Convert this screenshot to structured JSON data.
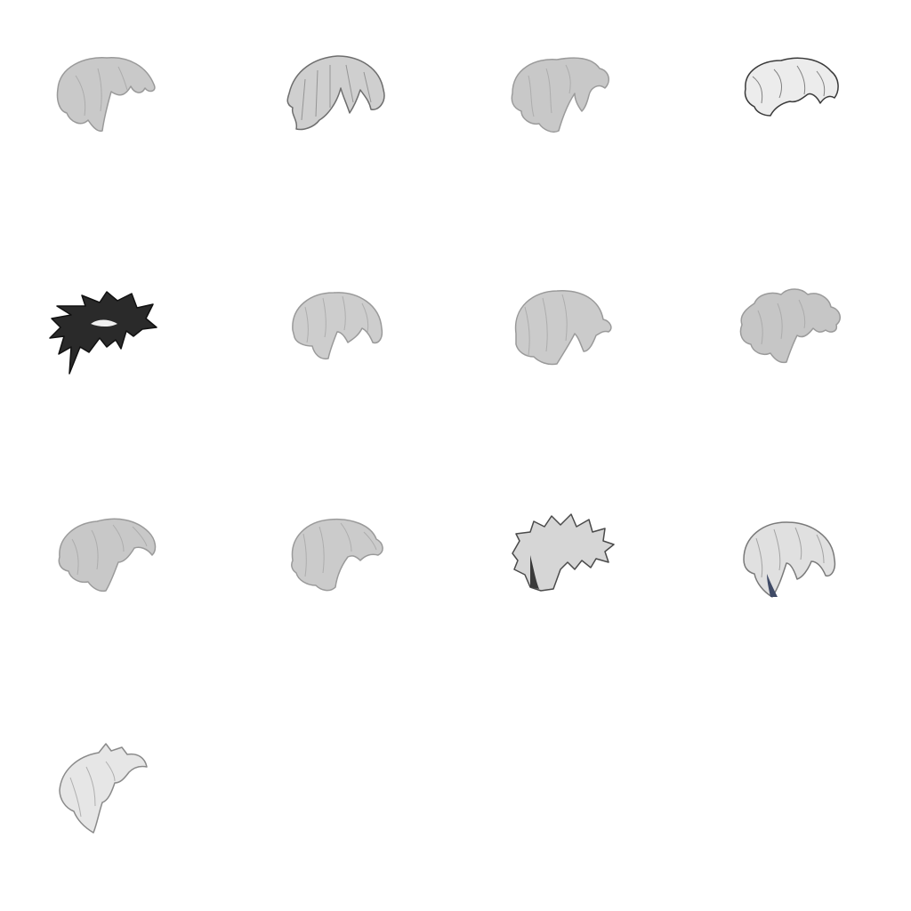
{
  "items": [
    {
      "icon": "hair-wavy-icon",
      "fill": "#c9c9c9",
      "stroke": "#9a9a9a"
    },
    {
      "icon": "hair-spiky-icon",
      "fill": "#cfcfcf",
      "stroke": "#6e6e6e"
    },
    {
      "icon": "hair-curly-icon",
      "fill": "#c8c8c8",
      "stroke": "#9b9b9b"
    },
    {
      "icon": "hair-messy-icon",
      "fill": "#ececec",
      "stroke": "#3a3a3a"
    },
    {
      "icon": "hair-spiky-dark-icon",
      "fill": "#2a2a2a",
      "stroke": "#111111"
    },
    {
      "icon": "hair-bob-icon",
      "fill": "#cdcdcd",
      "stroke": "#9a9a9a"
    },
    {
      "icon": "hair-long-bob-icon",
      "fill": "#cbcbcb",
      "stroke": "#9a9a9a"
    },
    {
      "icon": "hair-fluffy-icon",
      "fill": "#c6c6c6",
      "stroke": "#9b9b9b"
    },
    {
      "icon": "hair-swept-icon",
      "fill": "#c8c8c8",
      "stroke": "#9b9b9b"
    },
    {
      "icon": "hair-swirl-icon",
      "fill": "#cbcbcb",
      "stroke": "#9a9a9a"
    },
    {
      "icon": "hair-shaggy-icon",
      "fill": "#d6d6d6",
      "stroke": "#4a4a4a"
    },
    {
      "icon": "hair-layered-icon",
      "fill": "#e0e0e0",
      "stroke": "#7a7a7a"
    },
    {
      "icon": "hair-feathered-icon",
      "fill": "#e6e6e6",
      "stroke": "#8a8a8a"
    }
  ]
}
